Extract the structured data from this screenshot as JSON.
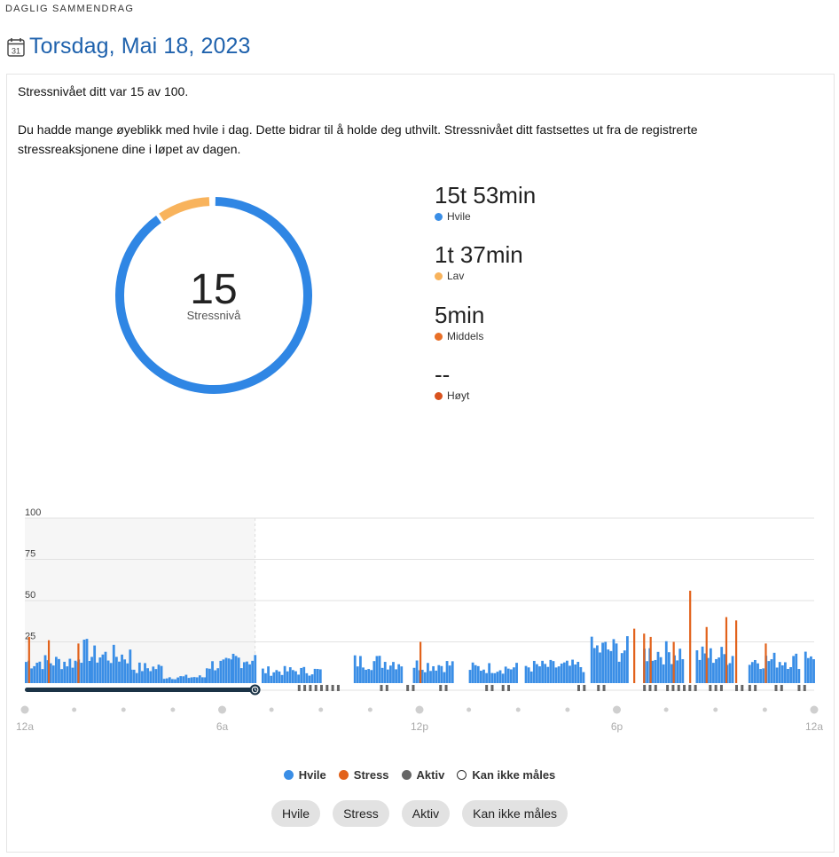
{
  "header": {
    "section_label": "DAGLIG SAMMENDRAG",
    "date_title": "Torsdag, Mai 18, 2023",
    "calendar_day": "31"
  },
  "summary": {
    "line1": "Stressnivået ditt var 15 av 100.",
    "line2": "Du hadde mange øyeblikk med hvile i dag. Dette bidrar til å holde deg uthvilt. Stressnivået ditt fastsettes ut fra de registrerte stressreaksjonene dine i løpet av dagen."
  },
  "donut": {
    "value": "15",
    "label": "Stressnivå",
    "segments": [
      {
        "name": "Hvile",
        "minutes": 953,
        "color": "#2f86e4"
      },
      {
        "name": "Lav",
        "minutes": 97,
        "color": "#f8b35c"
      },
      {
        "name": "Middels",
        "minutes": 5,
        "color": "#e2621b"
      }
    ]
  },
  "stats": [
    {
      "value": "15t 53min",
      "label": "Hvile",
      "color": "#3a8ee6"
    },
    {
      "value": "1t 37min",
      "label": "Lav",
      "color": "#f8b35c"
    },
    {
      "value": "5min",
      "label": "Middels",
      "color": "#e86f27"
    },
    {
      "value": "--",
      "label": "Høyt",
      "color": "#d9531e"
    }
  ],
  "colors": {
    "rest": "#3a8ee6",
    "stress": "#e2621b",
    "active": "#666666",
    "sleep_bar": "#1b3346",
    "title_blue": "#1f62ad"
  },
  "chart_data": {
    "type": "bar",
    "ylim": [
      0,
      100
    ],
    "yticks": [
      "100",
      "75",
      "50",
      "25"
    ],
    "xticks": [
      "12a",
      "6a",
      "12p",
      "6p",
      "12a"
    ],
    "sleep_end_hour": 7.0,
    "resolution_minutes": 5,
    "rest_segments": [
      {
        "from": 0.0,
        "to": 1.6,
        "level": 14
      },
      {
        "from": 1.6,
        "to": 2.0,
        "level": 21
      },
      {
        "from": 2.0,
        "to": 3.2,
        "level": 18
      },
      {
        "from": 3.2,
        "to": 4.2,
        "level": 10
      },
      {
        "from": 4.2,
        "to": 5.5,
        "level": 4
      },
      {
        "from": 5.5,
        "to": 6.3,
        "level": 12
      },
      {
        "from": 6.3,
        "to": 7.0,
        "level": 16
      },
      {
        "from": 7.2,
        "to": 9.0,
        "level": 8
      },
      {
        "from": 10.0,
        "to": 11.5,
        "level": 14
      },
      {
        "from": 11.8,
        "to": 13.0,
        "level": 12
      },
      {
        "from": 13.5,
        "to": 15.0,
        "level": 10
      },
      {
        "from": 15.2,
        "to": 17.0,
        "level": 11
      },
      {
        "from": 17.2,
        "to": 18.3,
        "level": 22
      },
      {
        "from": 18.8,
        "to": 20.0,
        "level": 20
      },
      {
        "from": 20.4,
        "to": 21.5,
        "level": 18
      },
      {
        "from": 22.0,
        "to": 23.5,
        "level": 15
      },
      {
        "from": 23.7,
        "to": 24.0,
        "level": 20
      }
    ],
    "stress_spikes": [
      {
        "hour": 0.1,
        "value": 28
      },
      {
        "hour": 0.7,
        "value": 26
      },
      {
        "hour": 1.6,
        "value": 24
      },
      {
        "hour": 12.0,
        "value": 25
      },
      {
        "hour": 18.5,
        "value": 33
      },
      {
        "hour": 18.8,
        "value": 30
      },
      {
        "hour": 19.0,
        "value": 28
      },
      {
        "hour": 19.7,
        "value": 25
      },
      {
        "hour": 20.2,
        "value": 56
      },
      {
        "hour": 20.7,
        "value": 34
      },
      {
        "hour": 21.3,
        "value": 40
      },
      {
        "hour": 21.6,
        "value": 38
      },
      {
        "hour": 22.5,
        "value": 24
      }
    ],
    "active_segments": [
      {
        "from": 8.3,
        "to": 9.5
      },
      {
        "from": 10.8,
        "to": 11.0
      },
      {
        "from": 11.6,
        "to": 11.8
      },
      {
        "from": 12.6,
        "to": 12.8
      },
      {
        "from": 14.0,
        "to": 14.2
      },
      {
        "from": 14.5,
        "to": 14.7
      },
      {
        "from": 16.8,
        "to": 17.0
      },
      {
        "from": 17.4,
        "to": 17.6
      },
      {
        "from": 18.8,
        "to": 19.3
      },
      {
        "from": 19.5,
        "to": 20.5
      },
      {
        "from": 20.8,
        "to": 21.3
      },
      {
        "from": 21.6,
        "to": 21.8
      },
      {
        "from": 22.0,
        "to": 22.3
      },
      {
        "from": 22.8,
        "to": 23.0
      },
      {
        "from": 23.5,
        "to": 23.7
      }
    ]
  },
  "legend": [
    {
      "label": "Hvile",
      "color": "#3a8ee6",
      "hollow": false
    },
    {
      "label": "Stress",
      "color": "#e2621b",
      "hollow": false
    },
    {
      "label": "Aktiv",
      "color": "#666666",
      "hollow": false
    },
    {
      "label": "Kan ikke måles",
      "color": "#ffffff",
      "hollow": true
    }
  ],
  "filters": [
    {
      "label": "Hvile"
    },
    {
      "label": "Stress"
    },
    {
      "label": "Aktiv"
    },
    {
      "label": "Kan ikke måles"
    }
  ]
}
